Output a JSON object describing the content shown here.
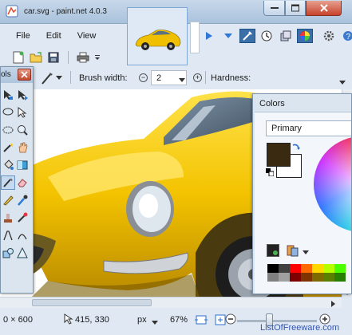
{
  "window": {
    "title": "car.svg - paint.net 4.0.3"
  },
  "menu": {
    "items": [
      "File",
      "Edit",
      "View"
    ]
  },
  "toolbar": {
    "brush_width_label": "Brush width:",
    "minus": "−",
    "brush_width_value": "2",
    "plus": "+",
    "hardness_label": "Hardness:"
  },
  "tools_window": {
    "title": "ols"
  },
  "colors_window": {
    "title": "Colors",
    "primary_select": "Primary",
    "primary_color": "#3a2a12",
    "secondary_color": "#ffffff",
    "palette": [
      "#000000",
      "#404040",
      "#ff0000",
      "#ff6a00",
      "#ffd800",
      "#b6ff00",
      "#4cff00",
      "#808080",
      "#a0a0a0",
      "#7f0000",
      "#7f3300",
      "#7f6a00",
      "#5b7f00",
      "#267f00"
    ]
  },
  "status": {
    "image_size": "0 × 600",
    "cursor_pos": "415, 330",
    "units": "px",
    "zoom": "67%",
    "zoom_level": 0.4
  },
  "watermark": "ListOfFreeware.com",
  "accent": "#f2c200"
}
